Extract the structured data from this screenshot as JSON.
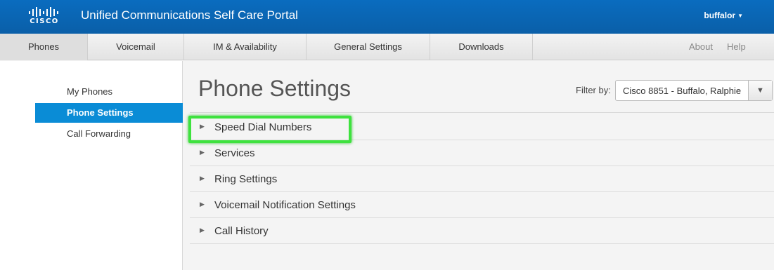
{
  "header": {
    "logo_text": "CISCO",
    "title": "Unified Communications Self Care Portal",
    "user": "buffalor"
  },
  "nav": {
    "tabs": [
      {
        "label": "Phones",
        "active": true
      },
      {
        "label": "Voicemail",
        "active": false
      },
      {
        "label": "IM & Availability",
        "active": false
      },
      {
        "label": "General Settings",
        "active": false
      },
      {
        "label": "Downloads",
        "active": false
      }
    ],
    "about": "About",
    "help": "Help"
  },
  "sidebar": {
    "items": [
      {
        "label": "My Phones",
        "active": false
      },
      {
        "label": "Phone Settings",
        "active": true
      },
      {
        "label": "Call Forwarding",
        "active": false
      }
    ]
  },
  "main": {
    "title": "Phone Settings",
    "filter": {
      "label": "Filter by:",
      "value": "Cisco 8851 - Buffalo, Ralphie"
    },
    "sections": [
      {
        "label": "Speed Dial Numbers",
        "expanded": false
      },
      {
        "label": "Services",
        "expanded": false
      },
      {
        "label": "Ring Settings",
        "expanded": false
      },
      {
        "label": "Voicemail Notification Settings",
        "expanded": false
      },
      {
        "label": "Call History",
        "expanded": false
      }
    ]
  },
  "colors": {
    "header_bg": "#0a6cbf",
    "active_sidebar": "#0a8cd6",
    "highlight": "#3ee23e"
  }
}
